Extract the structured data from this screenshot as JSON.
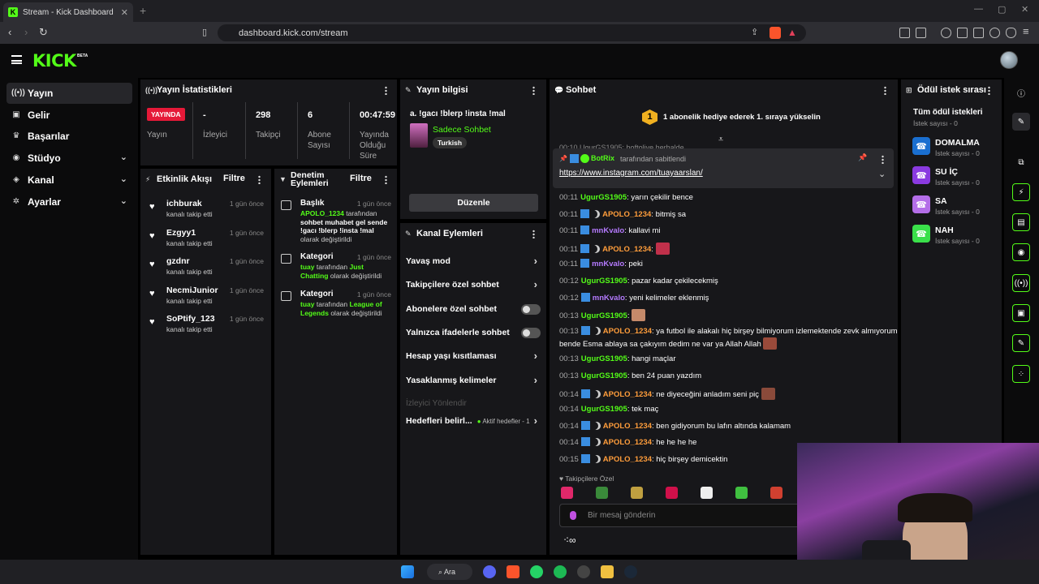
{
  "browser": {
    "tab_title": "Stream - Kick Dashboard",
    "url": "dashboard.kick.com/stream"
  },
  "header": {
    "logo": "KICK",
    "beta": "BETA"
  },
  "sidebar": {
    "items": [
      {
        "label": "Yayın",
        "icon": "broadcast-icon",
        "active": true
      },
      {
        "label": "Gelir",
        "icon": "wallet-icon"
      },
      {
        "label": "Başarılar",
        "icon": "trophy-icon"
      },
      {
        "label": "Stüdyo",
        "icon": "video-icon",
        "expandable": true
      },
      {
        "label": "Kanal",
        "icon": "layers-icon",
        "expandable": true
      },
      {
        "label": "Ayarlar",
        "icon": "gear-icon",
        "expandable": true
      }
    ]
  },
  "stats": {
    "title": "Yayın İstatistikleri",
    "live_badge": "YAYINDA",
    "live_label": "Yayın",
    "items": [
      {
        "value": "-",
        "label": "İzleyici"
      },
      {
        "value": "298",
        "label": "Takipçi"
      },
      {
        "value": "6",
        "label": "Abone Sayısı"
      },
      {
        "value": "00:47:59",
        "label": "Yayında Olduğu Süre"
      }
    ]
  },
  "activity": {
    "title": "Etkinlik Akışı",
    "filter": "Filtre",
    "events": [
      {
        "name": "ichburak",
        "desc": "kanalı takip etti",
        "time": "1 gün önce"
      },
      {
        "name": "Ezgyy1",
        "desc": "kanalı takip etti",
        "time": "1 gün önce"
      },
      {
        "name": "gzdnr",
        "desc": "kanalı takip etti",
        "time": "1 gün önce"
      },
      {
        "name": "NecmiJunior",
        "desc": "kanalı takip etti",
        "time": "1 gün önce"
      },
      {
        "name": "SoPtify_123",
        "desc": "kanalı takip etti",
        "time": "1 gün önce"
      }
    ]
  },
  "moderation": {
    "title": "Denetim Eylemleri",
    "filter": "Filtre",
    "items": [
      {
        "title": "Başlık",
        "time": "1 gün önce",
        "actor": "APOLO_1234",
        "pre": "tarafından",
        "value": "sohbet muhabet gel sende !gacı !blerp !insta !mal",
        "post": "olarak değiştirildi"
      },
      {
        "title": "Kategori",
        "time": "1 gün önce",
        "actor": "tuay",
        "pre": "tarafından",
        "value": "Just Chatting",
        "post": "olarak değiştirildi"
      },
      {
        "title": "Kategori",
        "time": "1 gün önce",
        "actor": "tuay",
        "pre": "tarafından",
        "value": "League of Legends",
        "post": "olarak değiştirildi"
      }
    ]
  },
  "stream_info": {
    "title": "Yayın bilgisi",
    "stream_title": "a. !gacı !blerp !insta !mal",
    "category": "Sadece Sohbet",
    "tag": "Turkish",
    "edit_button": "Düzenle"
  },
  "channel_actions": {
    "title": "Kanal Eylemleri",
    "items": [
      {
        "label": "Yavaş mod",
        "kind": "arrow"
      },
      {
        "label": "Takipçilere özel sohbet",
        "kind": "arrow"
      },
      {
        "label": "Abonelere özel sohbet",
        "kind": "toggle"
      },
      {
        "label": "Yalnızca ifadelerle sohbet",
        "kind": "toggle"
      },
      {
        "label": "Hesap yaşı kısıtlaması",
        "kind": "arrow"
      },
      {
        "label": "Yasaklanmış kelimeler",
        "kind": "arrow"
      },
      {
        "label": "İzleyici Yönlendir",
        "kind": "disabled"
      }
    ],
    "goals_label": "Hedefleri belirl...",
    "goals_status": "Aktif hedefler - 1"
  },
  "chat": {
    "title": "Sohbet",
    "gift_rank": "1",
    "gift_text": "1 abonelik hediye ederek 1. sıraya yükselin",
    "partial_line": "00:10 UgurGS1905: hoftoliye herhalde",
    "pinned": {
      "by": "BotRix",
      "by_suffix": "tarafından sabitlendi",
      "link": "https://www.instagram.com/tuayaarslan/"
    },
    "messages": [
      {
        "time": "00:11",
        "user": "UgurGS1905",
        "c": "u1",
        "badges": [],
        "text": "yarın çekilir bence"
      },
      {
        "time": "00:11",
        "user": "APOLO_1234",
        "c": "u2",
        "badges": [
          "b1",
          "b2"
        ],
        "text": "bitmiş sa"
      },
      {
        "time": "00:11",
        "user": "mnKvalo",
        "c": "u3",
        "badges": [
          "b1"
        ],
        "text": "kallavi mi"
      },
      {
        "time": "00:11",
        "user": "APOLO_1234",
        "c": "u2",
        "badges": [
          "b1",
          "b2"
        ],
        "text": "",
        "emote": "#c0304a"
      },
      {
        "time": "00:11",
        "user": "mnKvalo",
        "c": "u3",
        "badges": [
          "b1"
        ],
        "text": "peki"
      },
      {
        "time": "00:12",
        "user": "UgurGS1905",
        "c": "u1",
        "badges": [],
        "text": "pazar kadar çekilecekmiş"
      },
      {
        "time": "00:12",
        "user": "mnKvalo",
        "c": "u3",
        "badges": [
          "b1"
        ],
        "text": "yeni kelimeler eklenmiş"
      },
      {
        "time": "00:13",
        "user": "UgurGS1905",
        "c": "u1",
        "badges": [],
        "text": "",
        "emote": "#c58a6a"
      },
      {
        "time": "00:13",
        "user": "APOLO_1234",
        "c": "u2",
        "badges": [
          "b1",
          "b2"
        ],
        "text": "ya futbol ile alakalı hiç birşey bilmiyorum izlemektende zevk almıyorum",
        "text2": "bende Esma ablaya sa çakıyım dedim ne var ya Allah Allah",
        "emote2": "#9a4a3a"
      },
      {
        "time": "00:13",
        "user": "UgurGS1905",
        "c": "u1",
        "badges": [],
        "text": "hangi maçlar"
      },
      {
        "time": "00:13",
        "user": "UgurGS1905",
        "c": "u1",
        "badges": [],
        "text": "ben 24 puan yazdım"
      },
      {
        "time": "00:14",
        "user": "APOLO_1234",
        "c": "u2",
        "badges": [
          "b1",
          "b2"
        ],
        "text": "ne diyeceğini anladım seni piç",
        "emote": "#8a4a3a"
      },
      {
        "time": "00:14",
        "user": "UgurGS1905",
        "c": "u1",
        "badges": [],
        "text": "tek maç"
      },
      {
        "time": "00:14",
        "user": "APOLO_1234",
        "c": "u2",
        "badges": [
          "b1",
          "b2"
        ],
        "text": "ben gidiyorum bu lafın altında kalamam"
      },
      {
        "time": "00:14",
        "user": "APOLO_1234",
        "c": "u2",
        "badges": [
          "b1",
          "b2"
        ],
        "text": "he he he he"
      },
      {
        "time": "00:15",
        "user": "APOLO_1234",
        "c": "u2",
        "badges": [
          "b1",
          "b2"
        ],
        "text": "hiç birşey demicektin"
      }
    ],
    "followers_only": "Takipçilere Özel",
    "emote_colors": [
      "#e0286a",
      "#3a8a3a",
      "#c0a040",
      "#d0104a",
      "#eeeeee",
      "#40c040",
      "#d04030"
    ],
    "input_placeholder": "Bir mesaj gönderin"
  },
  "rewards": {
    "title": "Ödül istek sırası",
    "all": "Tüm ödül istekleri",
    "all_count": "İstek sayısı - 0",
    "items": [
      {
        "name": "DOMALMA",
        "count": "İstek sayısı - 0",
        "color": "#1a6fd0"
      },
      {
        "name": "SU İÇ",
        "count": "İstek sayısı - 0",
        "color": "#8a3ae0"
      },
      {
        "name": "SA",
        "count": "İstek sayısı - 0",
        "color": "#b46ee8"
      },
      {
        "name": "NAH",
        "count": "İstek sayısı - 0",
        "color": "#3ae04a"
      }
    ]
  },
  "taskbar": {
    "search": "Ara"
  }
}
